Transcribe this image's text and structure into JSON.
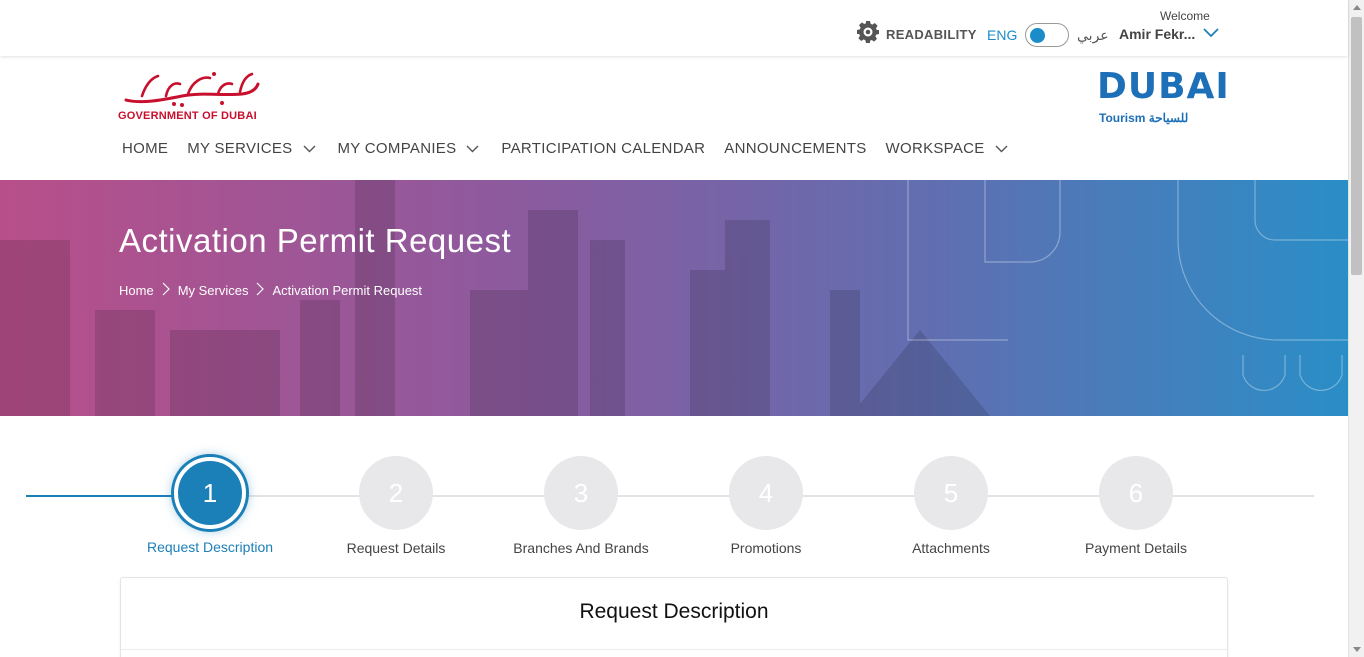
{
  "topbar": {
    "readability_label": "READABILITY",
    "lang_en": "ENG",
    "lang_ar": "عربي",
    "welcome": "Welcome",
    "user_name": "Amir Fekr..."
  },
  "logos": {
    "gov_ar": "حكومة دبي",
    "gov_en": "GOVERNMENT OF DUBAI",
    "dt_main": "DUBAI",
    "dt_sub": "Tourism للسياحة"
  },
  "nav": {
    "home": "HOME",
    "my_services": "MY SERVICES",
    "my_companies": "MY COMPANIES",
    "participation_calendar": "PARTICIPATION CALENDAR",
    "announcements": "ANNOUNCEMENTS",
    "workspace": "WORKSPACE"
  },
  "banner": {
    "title": "Activation Permit Request",
    "breadcrumb": [
      "Home",
      "My Services",
      "Activation Permit Request"
    ]
  },
  "stepper": {
    "active_step": 1,
    "steps": [
      {
        "number": "1",
        "label": "Request Description"
      },
      {
        "number": "2",
        "label": "Request Details"
      },
      {
        "number": "3",
        "label": "Branches And Brands"
      },
      {
        "number": "4",
        "label": "Promotions"
      },
      {
        "number": "5",
        "label": "Attachments"
      },
      {
        "number": "6",
        "label": "Payment Details"
      }
    ]
  },
  "card": {
    "title": "Request Description"
  },
  "colors": {
    "accent": "#1b7fb8",
    "gov_red": "#c8102e",
    "dt_blue": "#1d6fb8"
  }
}
